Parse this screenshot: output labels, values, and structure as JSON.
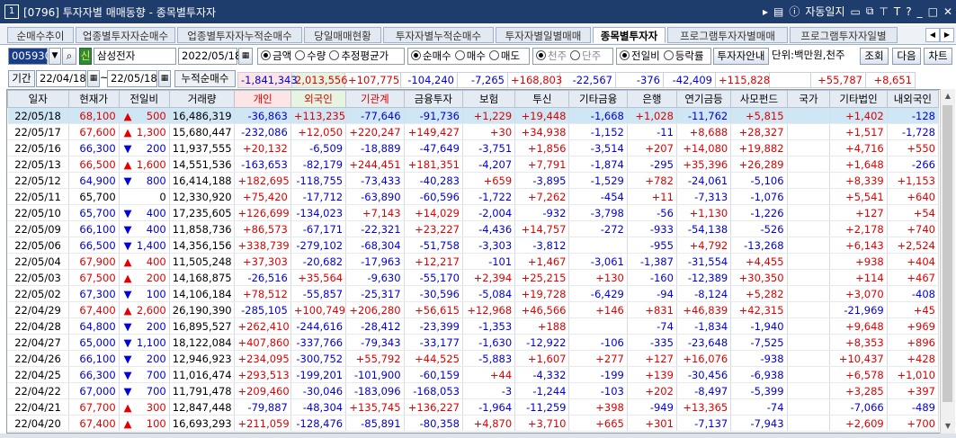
{
  "window": {
    "number": "1",
    "title": "[0796] 투자자별 매매동향 - 종목별투자자",
    "auto_log": "자동일지",
    "buttons": [
      "▸",
      "m",
      "T",
      "?",
      "_",
      "□",
      "✕"
    ]
  },
  "tabs": [
    {
      "label": "순매수추이"
    },
    {
      "label": "업종별투자자순매수"
    },
    {
      "label": "업종별투자자누적순매수"
    },
    {
      "label": "당일매매현황"
    },
    {
      "label": "투자자별누적순매수"
    },
    {
      "label": "투자자별일별매매"
    },
    {
      "label": "종목별투자자",
      "active": true
    },
    {
      "label": "프로그램투자자별매매"
    },
    {
      "label": "프로그램투자자일별"
    }
  ],
  "toolbar": {
    "code": "005930",
    "badge": "신",
    "name": "삼성전자",
    "date": "2022/05/18",
    "unit_options": [
      {
        "label": "금액",
        "on": true
      },
      {
        "label": "수량",
        "on": false
      },
      {
        "label": "추정평균가",
        "on": false
      }
    ],
    "trade_options": [
      {
        "label": "순매수",
        "on": true
      },
      {
        "label": "매수",
        "on": false
      },
      {
        "label": "매도",
        "on": false
      }
    ],
    "unit_options2": [
      {
        "label": "천주",
        "on": true
      },
      {
        "label": "단주",
        "on": false
      }
    ],
    "compare_options": [
      {
        "label": "전일비",
        "on": true
      },
      {
        "label": "등락률",
        "on": false
      }
    ],
    "guide_button": "투자자안내",
    "unit_label": "단위:백만원,천주",
    "query_button": "조회",
    "next_button": "다음",
    "chart_button": "차트"
  },
  "filter": {
    "period_label": "기간",
    "start_date": "22/04/18",
    "end_date": "22/05/18",
    "cumulative_label": "누적순매수"
  },
  "summary": [
    "-1,841,343",
    "2,013,556",
    "+107,775",
    "-104,240",
    "-7,265",
    "+168,803",
    "-22,567",
    "-376",
    "-42,409",
    "+115,828",
    "",
    "+55,787",
    "+8,651"
  ],
  "columns": [
    "일자",
    "현재가",
    "전일비",
    "거래량",
    "개인",
    "외국인",
    "기관계",
    "금융투자",
    "보험",
    "투신",
    "기타금융",
    "은행",
    "연기금등",
    "사모펀드",
    "국가",
    "기타법인",
    "내외국인"
  ],
  "rows": [
    [
      "22/05/18",
      "68,100",
      "up",
      "500",
      "16,486,319",
      "-36,863",
      "+113,235",
      "-77,646",
      "-91,736",
      "+1,229",
      "+19,448",
      "-1,668",
      "+1,028",
      "-11,762",
      "+5,815",
      "",
      "+1,402",
      "-128"
    ],
    [
      "22/05/17",
      "67,600",
      "up",
      "1,300",
      "15,680,447",
      "-232,086",
      "+12,050",
      "+220,247",
      "+149,427",
      "+30",
      "+34,938",
      "-1,152",
      "-11",
      "+8,688",
      "+28,327",
      "",
      "+1,517",
      "-1,728"
    ],
    [
      "22/05/16",
      "66,300",
      "dn",
      "200",
      "11,937,555",
      "+20,132",
      "-6,509",
      "-18,889",
      "-47,649",
      "-3,751",
      "+1,856",
      "-3,514",
      "+207",
      "+14,080",
      "+19,882",
      "",
      "+4,716",
      "+550"
    ],
    [
      "22/05/13",
      "66,500",
      "up",
      "1,600",
      "14,551,536",
      "-163,653",
      "-82,179",
      "+244,451",
      "+181,351",
      "-4,207",
      "+7,791",
      "-1,874",
      "-295",
      "+35,396",
      "+26,289",
      "",
      "+1,648",
      "-266"
    ],
    [
      "22/05/12",
      "64,900",
      "dn",
      "800",
      "16,414,188",
      "+182,695",
      "-118,755",
      "-73,433",
      "-40,283",
      "+659",
      "-3,895",
      "-1,529",
      "+782",
      "-24,061",
      "-5,106",
      "",
      "+8,339",
      "+1,153"
    ],
    [
      "22/05/11",
      "65,700",
      "",
      "0",
      "12,330,920",
      "+75,420",
      "-17,712",
      "-63,890",
      "-60,596",
      "-1,722",
      "+7,262",
      "-454",
      "+11",
      "-7,313",
      "-1,076",
      "",
      "+5,541",
      "+640"
    ],
    [
      "22/05/10",
      "65,700",
      "dn",
      "400",
      "17,235,605",
      "+126,699",
      "-134,023",
      "+7,143",
      "+14,029",
      "-2,004",
      "-932",
      "-3,798",
      "-56",
      "+1,130",
      "-1,226",
      "",
      "+127",
      "+54"
    ],
    [
      "22/05/09",
      "66,100",
      "dn",
      "400",
      "11,858,736",
      "+86,573",
      "-67,171",
      "-22,321",
      "+23,227",
      "-4,436",
      "+14,757",
      "-272",
      "-933",
      "-54,138",
      "-526",
      "",
      "+2,178",
      "+740"
    ],
    [
      "22/05/06",
      "66,500",
      "dn",
      "1,400",
      "14,356,156",
      "+338,739",
      "-279,102",
      "-68,304",
      "-51,758",
      "-3,303",
      "-3,812",
      "",
      "-955",
      "+4,792",
      "-13,268",
      "",
      "+6,143",
      "+2,524"
    ],
    [
      "22/05/04",
      "67,900",
      "up",
      "400",
      "11,505,248",
      "+37,303",
      "-20,682",
      "-17,963",
      "+12,217",
      "-101",
      "+1,467",
      "-3,061",
      "-1,387",
      "-31,554",
      "+4,455",
      "",
      "+938",
      "+404"
    ],
    [
      "22/05/03",
      "67,500",
      "up",
      "200",
      "14,168,875",
      "-26,516",
      "+35,564",
      "-9,630",
      "-55,170",
      "+2,394",
      "+25,215",
      "+130",
      "-160",
      "-12,389",
      "+30,350",
      "",
      "+114",
      "+467"
    ],
    [
      "22/05/02",
      "67,300",
      "dn",
      "100",
      "14,106,184",
      "+78,512",
      "-55,857",
      "-25,317",
      "-30,596",
      "-5,084",
      "+19,728",
      "-6,429",
      "-94",
      "-8,124",
      "+5,282",
      "",
      "+3,070",
      "-408"
    ],
    [
      "22/04/29",
      "67,400",
      "up",
      "2,600",
      "26,190,390",
      "-285,105",
      "+100,749",
      "+206,280",
      "+56,615",
      "+12,968",
      "+46,566",
      "+146",
      "+831",
      "+46,839",
      "+42,315",
      "",
      "-21,969",
      "+45"
    ],
    [
      "22/04/28",
      "64,800",
      "dn",
      "200",
      "16,895,527",
      "+262,410",
      "-244,616",
      "-28,412",
      "-23,399",
      "-1,353",
      "+188",
      "",
      "-74",
      "-1,834",
      "-1,940",
      "",
      "+9,648",
      "+969"
    ],
    [
      "22/04/27",
      "65,000",
      "dn",
      "1,100",
      "18,122,084",
      "+407,860",
      "-337,766",
      "-79,343",
      "-33,177",
      "-1,630",
      "-12,922",
      "-106",
      "-335",
      "-23,648",
      "-7,525",
      "",
      "+8,353",
      "+896"
    ],
    [
      "22/04/26",
      "66,100",
      "dn",
      "200",
      "12,946,923",
      "+234,095",
      "-300,752",
      "+55,792",
      "+44,525",
      "-5,883",
      "+1,607",
      "+277",
      "+127",
      "+16,076",
      "-938",
      "",
      "+10,437",
      "+428"
    ],
    [
      "22/04/25",
      "66,300",
      "dn",
      "700",
      "11,016,474",
      "+293,513",
      "-199,201",
      "-101,900",
      "-60,159",
      "+44",
      "-4,332",
      "-199",
      "+139",
      "-30,456",
      "-6,938",
      "",
      "+6,578",
      "+1,010"
    ],
    [
      "22/04/22",
      "67,000",
      "dn",
      "700",
      "11,791,478",
      "+209,460",
      "-30,046",
      "-183,096",
      "-168,053",
      "-3",
      "-1,244",
      "-103",
      "+202",
      "-8,497",
      "-5,399",
      "",
      "+3,285",
      "+397"
    ],
    [
      "22/04/21",
      "67,700",
      "up",
      "300",
      "12,847,448",
      "-79,887",
      "-48,304",
      "+135,745",
      "+136,227",
      "-1,964",
      "-11,259",
      "+398",
      "-949",
      "+13,365",
      "-74",
      "",
      "-7,066",
      "-489"
    ],
    [
      "22/04/20",
      "67,400",
      "up",
      "100",
      "16,693,293",
      "+211,059",
      "-128,476",
      "-85,891",
      "-80,358",
      "+4,870",
      "+3,710",
      "+665",
      "+301",
      "-7,137",
      "-7,943",
      "",
      "+2,609",
      "+700"
    ]
  ]
}
